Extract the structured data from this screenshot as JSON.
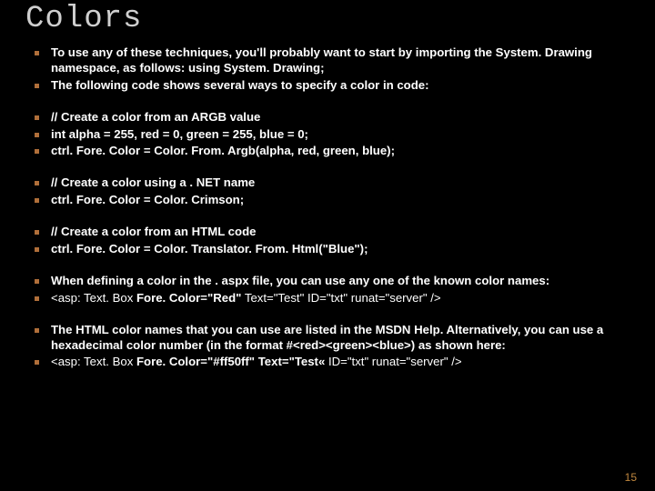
{
  "title": "Colors",
  "bullets": {
    "b1": "To use any of these techniques, you'll probably want to start by importing the System. Drawing namespace, as follows: using System. Drawing;",
    "b2": "The following code shows several ways to specify a color in code:",
    "b3": "// Create a color from an ARGB value",
    "b4": "int alpha = 255, red = 0, green = 255, blue = 0;",
    "b5": "ctrl. Fore. Color = Color. From. Argb(alpha, red, green, blue);",
    "b6": "// Create a color using a . NET name",
    "b7": "ctrl. Fore. Color = Color. Crimson;",
    "b8": "// Create a color from an HTML code",
    "b9": "ctrl. Fore. Color = Color. Translator. From. Html(\"Blue\");",
    "b10": "When defining a color in the . aspx file, you can use any one of the known color names:",
    "b11_pre": "<asp: Text. Box ",
    "b11_bold": "Fore. Color=\"Red\"",
    "b11_post": " Text=\"Test\" ID=\"txt\" runat=\"server\" />",
    "b12": "The HTML color names that you can use are listed in the MSDN Help. Alternatively, you can use a hexadecimal color number (in the format #<red><green><blue>) as shown here:",
    "b13_pre": "<asp: Text. Box ",
    "b13_bold": "Fore. Color=\"#ff50ff\" Text=\"Test«",
    "b13_post": " ID=\"txt\" runat=\"server\" />"
  },
  "page_number": "15"
}
